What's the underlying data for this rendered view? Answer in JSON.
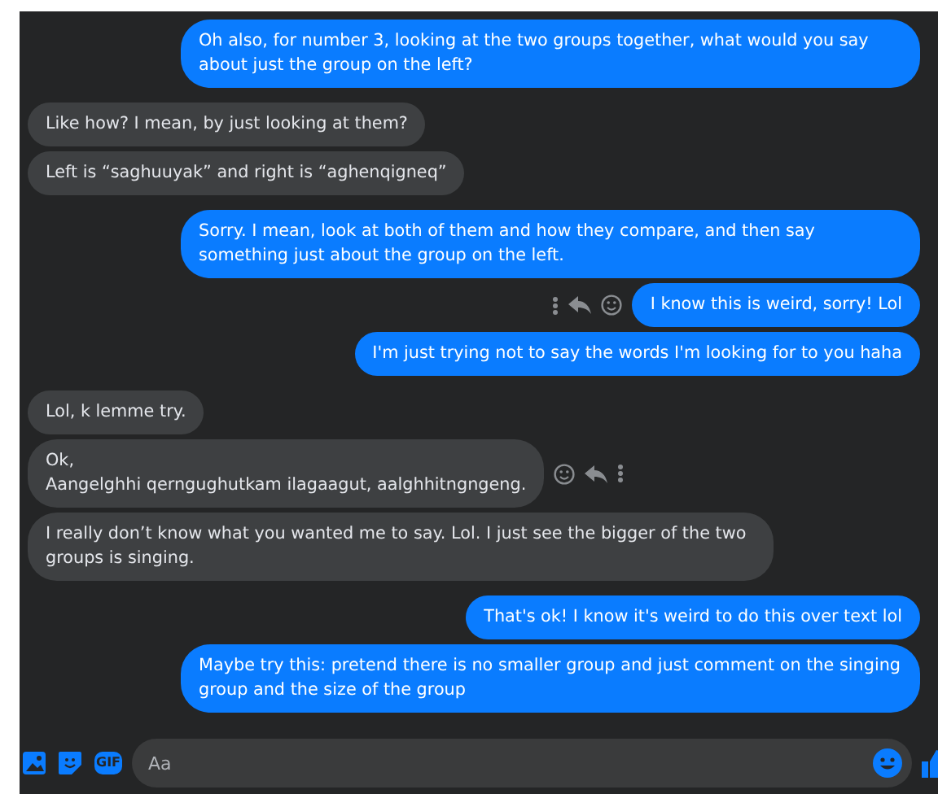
{
  "messages": [
    {
      "kind": "sent",
      "text": "Oh also, for number 3, looking at the two groups together, what would you say about just the group on the left?",
      "actions": false
    },
    {
      "kind": "received",
      "text": "Like how? I mean, by just looking at them?",
      "actions": false
    },
    {
      "kind": "received",
      "text": "Left is “saghuuyak” and right is “aghenqigneq”",
      "actions": false
    },
    {
      "kind": "sent",
      "text": "Sorry. I mean, look at both of them and how they compare, and then say something just about the group on the left.",
      "actions": false
    },
    {
      "kind": "sent",
      "text": "I know this is weird, sorry! Lol",
      "actions": true
    },
    {
      "kind": "sent",
      "text": "I'm just trying not to say the words I'm looking for to you haha",
      "actions": false
    },
    {
      "kind": "received",
      "text": "Lol, k lemme try.",
      "actions": false
    },
    {
      "kind": "received",
      "text": "Ok,\nAangelghhi qerngughutkam ilagaagut, aalghhitngngeng.",
      "actions": true
    },
    {
      "kind": "received",
      "text": "I really don’t know what you wanted me to say. Lol. I just see the bigger of the two groups is singing.",
      "actions": false
    },
    {
      "kind": "sent",
      "text": "That's ok! I know it's weird to do this over text lol",
      "actions": false
    },
    {
      "kind": "sent",
      "text": "Maybe try this: pretend there is no smaller group and just comment on the singing group and the size of the group",
      "actions": false
    }
  ],
  "composer": {
    "gif_label": "GIF",
    "placeholder": "Aa"
  }
}
